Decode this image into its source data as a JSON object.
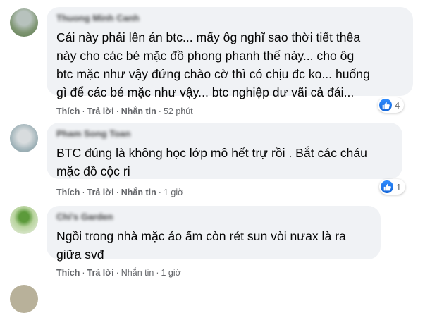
{
  "comments": [
    {
      "author": "Thuong Minh Canh",
      "lines": [
        "Cái này phải lên án btc... mấy ôg nghĩ sao thời tiết thêa",
        "này cho các bé mặc đồ phong phanh thế này... cho ôg",
        "btc mặc như vậy đứng chào cờ thì có chịu đc ko... huống",
        "gì để các bé mặc như vậy... btc nghiệp dư vãi cả đái..."
      ],
      "actions": {
        "like": "Thích",
        "reply": "Trả lời",
        "message": "Nhắn tin"
      },
      "time": "52 phút",
      "reaction_count": "4",
      "avatar_colors": [
        "#9aa6a0",
        "#6f8a62"
      ]
    },
    {
      "author": "Pham Song Toan",
      "lines": [
        "BTC đúng là không học lớp mô hết trự rồi . Bắt các cháu",
        "mặc đồ cộc ri"
      ],
      "actions": {
        "like": "Thích",
        "reply": "Trả lời",
        "message": "Nhắn tin"
      },
      "time": "1 giờ",
      "reaction_count": "1",
      "avatar_colors": [
        "#cfd3d6",
        "#8da2a8"
      ]
    },
    {
      "author": "Chi's Garden",
      "lines": [
        "Ngồi trong nhà mặc áo ấm còn rét sun vòi nưax là ra",
        "giữa svđ"
      ],
      "actions": {
        "like": "Thích",
        "reply": "Trả lời",
        "message": "Nhắn tin"
      },
      "time": "1 giờ",
      "reaction_count": "",
      "avatar_colors": [
        "#e4ecd9",
        "#6ea04a"
      ]
    }
  ],
  "separator": "·",
  "colors": {
    "bubble": "#f0f2f5",
    "meta": "#65676b",
    "like_blue": "#1877f2"
  }
}
